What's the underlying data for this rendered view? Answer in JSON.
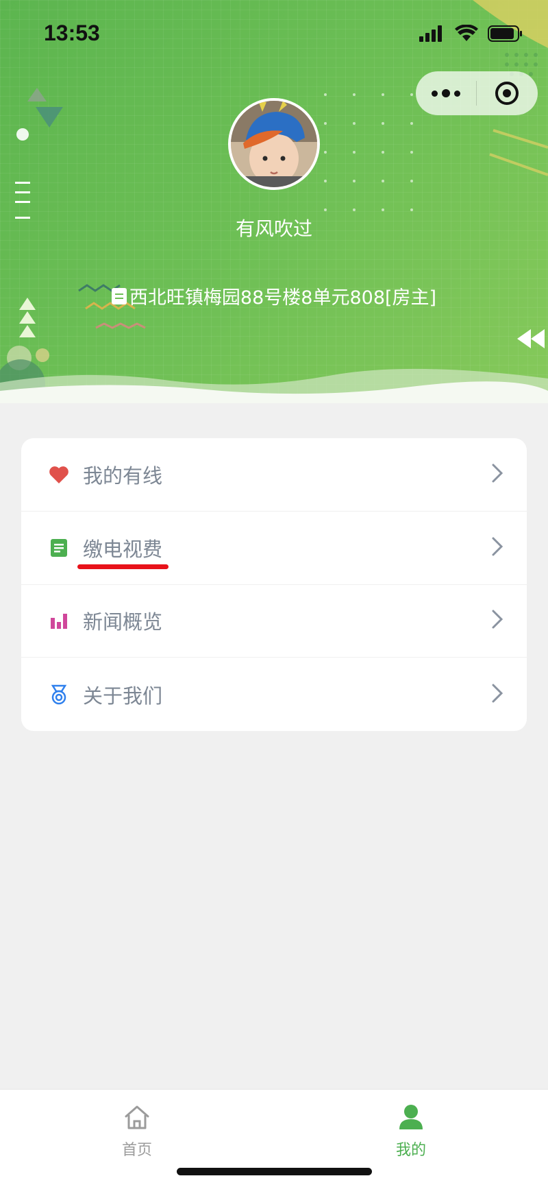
{
  "status_bar": {
    "time": "13:53"
  },
  "capsule": {
    "more_icon": "more-dots-icon",
    "close_icon": "target-close-icon"
  },
  "profile": {
    "nickname": "有风吹过",
    "address": "西北旺镇梅园88号楼8单元808[房主]",
    "address_icon": "id-card-icon"
  },
  "menu": {
    "items": [
      {
        "label": "我的有线",
        "icon": "heart-icon",
        "icon_color": "#e0514b"
      },
      {
        "label": "缴电视费",
        "icon": "bill-icon",
        "icon_color": "#4caf50"
      },
      {
        "label": "新闻概览",
        "icon": "bar-chart-icon",
        "icon_color": "#d0479b"
      },
      {
        "label": "关于我们",
        "icon": "medal-icon",
        "icon_color": "#2f80ed"
      }
    ]
  },
  "tabbar": {
    "home": {
      "label": "首页",
      "color": "#999999"
    },
    "mine": {
      "label": "我的",
      "color": "#4caf50"
    }
  },
  "colors": {
    "banner_green": "#6dbf55",
    "highlight_underline": "#e8121a"
  }
}
